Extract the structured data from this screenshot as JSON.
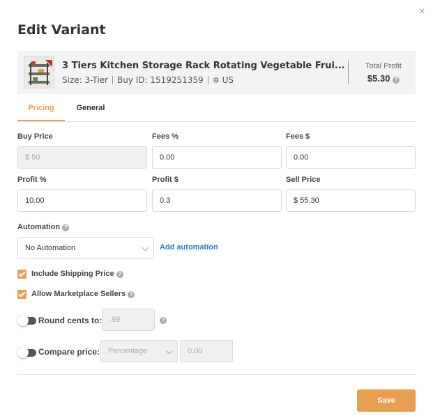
{
  "dialog": {
    "title": "Edit Variant",
    "close_symbol": "×"
  },
  "product": {
    "name": "3 Tiers Kitchen Storage Rack Rotating Vegetable Frui...",
    "size": "Size: 3-Tier",
    "buy_id": "Buy ID: 1519251359",
    "marketplace": "US",
    "total_profit_label": "Total Profit",
    "total_profit_value": "$5.30"
  },
  "tabs": [
    {
      "label": "Pricing",
      "active": true
    },
    {
      "label": "General",
      "active": false
    }
  ],
  "fields": {
    "buy_price": {
      "label": "Buy Price",
      "value": "$ 50"
    },
    "fees_pct": {
      "label": "Fees %",
      "value": "0.00"
    },
    "fees_usd": {
      "label": "Fees $",
      "value": "0.00"
    },
    "profit_pct": {
      "label": "Profit %",
      "value": "10.00"
    },
    "profit_usd": {
      "label": "Profit $",
      "value": "0.3"
    },
    "sell_price": {
      "label": "Sell Price",
      "value": "$ 55.30"
    }
  },
  "automation": {
    "label": "Automation",
    "selected": "No Automation",
    "add_link": "Add automation"
  },
  "checkboxes": {
    "include_shipping": {
      "label": "Include Shipping Price",
      "checked": true
    },
    "allow_marketplace": {
      "label": "Allow Marketplace Sellers",
      "checked": true
    }
  },
  "round_cents": {
    "label": "Round cents to:",
    "enabled": false,
    "placeholder": ".99"
  },
  "compare_price": {
    "label": "Compare price:",
    "enabled": false,
    "mode": "Percentage",
    "value": "0.00"
  },
  "actions": {
    "save_label": "Save"
  },
  "colors": {
    "accent": "#e8a050",
    "link": "#2a7ad8",
    "panel": "#f2f3f5"
  }
}
